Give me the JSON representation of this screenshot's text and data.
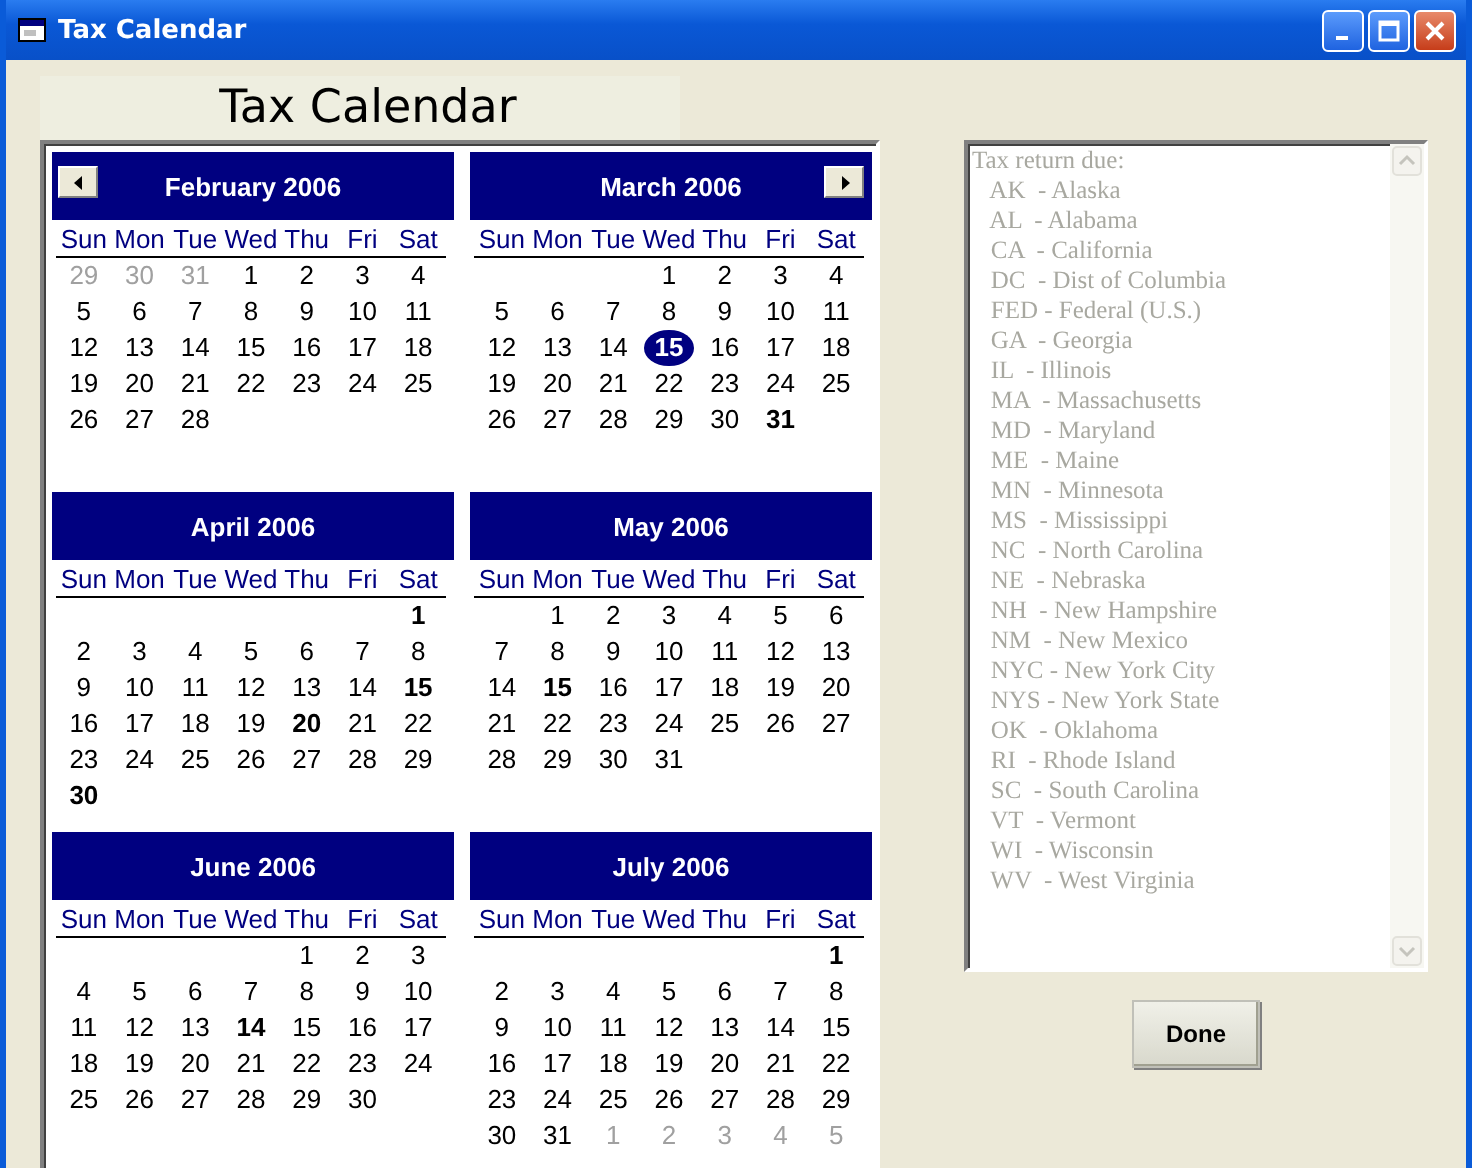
{
  "window": {
    "title": "Tax Calendar"
  },
  "heading": "Tax Calendar",
  "calendar": {
    "months": [
      {
        "title": "February 2006",
        "prev_button": true,
        "next_button": false,
        "weekdays": [
          "Sun",
          "Mon",
          "Tue",
          "Wed",
          "Thu",
          "Fri",
          "Sat"
        ],
        "weeks": [
          [
            {
              "day": "29",
              "kind": "adjacent"
            },
            {
              "day": "30",
              "kind": "adjacent"
            },
            {
              "day": "31",
              "kind": "adjacent"
            },
            {
              "day": "1",
              "kind": "normal"
            },
            {
              "day": "2",
              "kind": "normal"
            },
            {
              "day": "3",
              "kind": "normal"
            },
            {
              "day": "4",
              "kind": "normal"
            }
          ],
          [
            {
              "day": "5",
              "kind": "normal"
            },
            {
              "day": "6",
              "kind": "normal"
            },
            {
              "day": "7",
              "kind": "normal"
            },
            {
              "day": "8",
              "kind": "normal"
            },
            {
              "day": "9",
              "kind": "normal"
            },
            {
              "day": "10",
              "kind": "normal"
            },
            {
              "day": "11",
              "kind": "normal"
            }
          ],
          [
            {
              "day": "12",
              "kind": "normal"
            },
            {
              "day": "13",
              "kind": "normal"
            },
            {
              "day": "14",
              "kind": "normal"
            },
            {
              "day": "15",
              "kind": "normal"
            },
            {
              "day": "16",
              "kind": "normal"
            },
            {
              "day": "17",
              "kind": "normal"
            },
            {
              "day": "18",
              "kind": "normal"
            }
          ],
          [
            {
              "day": "19",
              "kind": "normal"
            },
            {
              "day": "20",
              "kind": "normal"
            },
            {
              "day": "21",
              "kind": "normal"
            },
            {
              "day": "22",
              "kind": "normal"
            },
            {
              "day": "23",
              "kind": "normal"
            },
            {
              "day": "24",
              "kind": "normal"
            },
            {
              "day": "25",
              "kind": "normal"
            }
          ],
          [
            {
              "day": "26",
              "kind": "normal"
            },
            {
              "day": "27",
              "kind": "normal"
            },
            {
              "day": "28",
              "kind": "normal"
            },
            {
              "kind": "blank"
            },
            {
              "kind": "blank"
            },
            {
              "kind": "blank"
            },
            {
              "kind": "blank"
            }
          ]
        ]
      },
      {
        "title": "March 2006",
        "prev_button": false,
        "next_button": true,
        "weekdays": [
          "Sun",
          "Mon",
          "Tue",
          "Wed",
          "Thu",
          "Fri",
          "Sat"
        ],
        "weeks": [
          [
            {
              "kind": "blank"
            },
            {
              "kind": "blank"
            },
            {
              "kind": "blank"
            },
            {
              "day": "1",
              "kind": "normal"
            },
            {
              "day": "2",
              "kind": "normal"
            },
            {
              "day": "3",
              "kind": "normal"
            },
            {
              "day": "4",
              "kind": "normal"
            }
          ],
          [
            {
              "day": "5",
              "kind": "normal"
            },
            {
              "day": "6",
              "kind": "normal"
            },
            {
              "day": "7",
              "kind": "normal"
            },
            {
              "day": "8",
              "kind": "normal"
            },
            {
              "day": "9",
              "kind": "normal"
            },
            {
              "day": "10",
              "kind": "normal"
            },
            {
              "day": "11",
              "kind": "normal"
            }
          ],
          [
            {
              "day": "12",
              "kind": "normal"
            },
            {
              "day": "13",
              "kind": "normal"
            },
            {
              "day": "14",
              "kind": "normal"
            },
            {
              "day": "15",
              "kind": "today"
            },
            {
              "day": "16",
              "kind": "normal"
            },
            {
              "day": "17",
              "kind": "normal"
            },
            {
              "day": "18",
              "kind": "normal"
            }
          ],
          [
            {
              "day": "19",
              "kind": "normal"
            },
            {
              "day": "20",
              "kind": "normal"
            },
            {
              "day": "21",
              "kind": "normal"
            },
            {
              "day": "22",
              "kind": "normal"
            },
            {
              "day": "23",
              "kind": "normal"
            },
            {
              "day": "24",
              "kind": "normal"
            },
            {
              "day": "25",
              "kind": "normal"
            }
          ],
          [
            {
              "day": "26",
              "kind": "normal"
            },
            {
              "day": "27",
              "kind": "normal"
            },
            {
              "day": "28",
              "kind": "normal"
            },
            {
              "day": "29",
              "kind": "normal"
            },
            {
              "day": "30",
              "kind": "normal"
            },
            {
              "day": "31",
              "kind": "bold"
            },
            {
              "kind": "blank"
            }
          ]
        ]
      },
      {
        "title": "April 2006",
        "prev_button": false,
        "next_button": false,
        "weekdays": [
          "Sun",
          "Mon",
          "Tue",
          "Wed",
          "Thu",
          "Fri",
          "Sat"
        ],
        "weeks": [
          [
            {
              "kind": "blank"
            },
            {
              "kind": "blank"
            },
            {
              "kind": "blank"
            },
            {
              "kind": "blank"
            },
            {
              "kind": "blank"
            },
            {
              "kind": "blank"
            },
            {
              "day": "1",
              "kind": "bold"
            }
          ],
          [
            {
              "day": "2",
              "kind": "normal"
            },
            {
              "day": "3",
              "kind": "normal"
            },
            {
              "day": "4",
              "kind": "normal"
            },
            {
              "day": "5",
              "kind": "normal"
            },
            {
              "day": "6",
              "kind": "normal"
            },
            {
              "day": "7",
              "kind": "normal"
            },
            {
              "day": "8",
              "kind": "normal"
            }
          ],
          [
            {
              "day": "9",
              "kind": "normal"
            },
            {
              "day": "10",
              "kind": "normal"
            },
            {
              "day": "11",
              "kind": "normal"
            },
            {
              "day": "12",
              "kind": "normal"
            },
            {
              "day": "13",
              "kind": "normal"
            },
            {
              "day": "14",
              "kind": "normal"
            },
            {
              "day": "15",
              "kind": "bold"
            }
          ],
          [
            {
              "day": "16",
              "kind": "normal"
            },
            {
              "day": "17",
              "kind": "normal"
            },
            {
              "day": "18",
              "kind": "normal"
            },
            {
              "day": "19",
              "kind": "normal"
            },
            {
              "day": "20",
              "kind": "bold"
            },
            {
              "day": "21",
              "kind": "normal"
            },
            {
              "day": "22",
              "kind": "normal"
            }
          ],
          [
            {
              "day": "23",
              "kind": "normal"
            },
            {
              "day": "24",
              "kind": "normal"
            },
            {
              "day": "25",
              "kind": "normal"
            },
            {
              "day": "26",
              "kind": "normal"
            },
            {
              "day": "27",
              "kind": "normal"
            },
            {
              "day": "28",
              "kind": "normal"
            },
            {
              "day": "29",
              "kind": "normal"
            }
          ],
          [
            {
              "day": "30",
              "kind": "bold"
            },
            {
              "kind": "blank"
            },
            {
              "kind": "blank"
            },
            {
              "kind": "blank"
            },
            {
              "kind": "blank"
            },
            {
              "kind": "blank"
            },
            {
              "kind": "blank"
            }
          ]
        ]
      },
      {
        "title": "May 2006",
        "prev_button": false,
        "next_button": false,
        "weekdays": [
          "Sun",
          "Mon",
          "Tue",
          "Wed",
          "Thu",
          "Fri",
          "Sat"
        ],
        "weeks": [
          [
            {
              "kind": "blank"
            },
            {
              "day": "1",
              "kind": "normal"
            },
            {
              "day": "2",
              "kind": "normal"
            },
            {
              "day": "3",
              "kind": "normal"
            },
            {
              "day": "4",
              "kind": "normal"
            },
            {
              "day": "5",
              "kind": "normal"
            },
            {
              "day": "6",
              "kind": "normal"
            }
          ],
          [
            {
              "day": "7",
              "kind": "normal"
            },
            {
              "day": "8",
              "kind": "normal"
            },
            {
              "day": "9",
              "kind": "normal"
            },
            {
              "day": "10",
              "kind": "normal"
            },
            {
              "day": "11",
              "kind": "normal"
            },
            {
              "day": "12",
              "kind": "normal"
            },
            {
              "day": "13",
              "kind": "normal"
            }
          ],
          [
            {
              "day": "14",
              "kind": "normal"
            },
            {
              "day": "15",
              "kind": "bold"
            },
            {
              "day": "16",
              "kind": "normal"
            },
            {
              "day": "17",
              "kind": "normal"
            },
            {
              "day": "18",
              "kind": "normal"
            },
            {
              "day": "19",
              "kind": "normal"
            },
            {
              "day": "20",
              "kind": "normal"
            }
          ],
          [
            {
              "day": "21",
              "kind": "normal"
            },
            {
              "day": "22",
              "kind": "normal"
            },
            {
              "day": "23",
              "kind": "normal"
            },
            {
              "day": "24",
              "kind": "normal"
            },
            {
              "day": "25",
              "kind": "normal"
            },
            {
              "day": "26",
              "kind": "normal"
            },
            {
              "day": "27",
              "kind": "normal"
            }
          ],
          [
            {
              "day": "28",
              "kind": "normal"
            },
            {
              "day": "29",
              "kind": "normal"
            },
            {
              "day": "30",
              "kind": "normal"
            },
            {
              "day": "31",
              "kind": "normal"
            },
            {
              "kind": "blank"
            },
            {
              "kind": "blank"
            },
            {
              "kind": "blank"
            }
          ]
        ]
      },
      {
        "title": "June 2006",
        "prev_button": false,
        "next_button": false,
        "weekdays": [
          "Sun",
          "Mon",
          "Tue",
          "Wed",
          "Thu",
          "Fri",
          "Sat"
        ],
        "weeks": [
          [
            {
              "kind": "blank"
            },
            {
              "kind": "blank"
            },
            {
              "kind": "blank"
            },
            {
              "kind": "blank"
            },
            {
              "day": "1",
              "kind": "normal"
            },
            {
              "day": "2",
              "kind": "normal"
            },
            {
              "day": "3",
              "kind": "normal"
            }
          ],
          [
            {
              "day": "4",
              "kind": "normal"
            },
            {
              "day": "5",
              "kind": "normal"
            },
            {
              "day": "6",
              "kind": "normal"
            },
            {
              "day": "7",
              "kind": "normal"
            },
            {
              "day": "8",
              "kind": "normal"
            },
            {
              "day": "9",
              "kind": "normal"
            },
            {
              "day": "10",
              "kind": "normal"
            }
          ],
          [
            {
              "day": "11",
              "kind": "normal"
            },
            {
              "day": "12",
              "kind": "normal"
            },
            {
              "day": "13",
              "kind": "normal"
            },
            {
              "day": "14",
              "kind": "bold"
            },
            {
              "day": "15",
              "kind": "normal"
            },
            {
              "day": "16",
              "kind": "normal"
            },
            {
              "day": "17",
              "kind": "normal"
            }
          ],
          [
            {
              "day": "18",
              "kind": "normal"
            },
            {
              "day": "19",
              "kind": "normal"
            },
            {
              "day": "20",
              "kind": "normal"
            },
            {
              "day": "21",
              "kind": "normal"
            },
            {
              "day": "22",
              "kind": "normal"
            },
            {
              "day": "23",
              "kind": "normal"
            },
            {
              "day": "24",
              "kind": "normal"
            }
          ],
          [
            {
              "day": "25",
              "kind": "normal"
            },
            {
              "day": "26",
              "kind": "normal"
            },
            {
              "day": "27",
              "kind": "normal"
            },
            {
              "day": "28",
              "kind": "normal"
            },
            {
              "day": "29",
              "kind": "normal"
            },
            {
              "day": "30",
              "kind": "normal"
            },
            {
              "kind": "blank"
            }
          ]
        ]
      },
      {
        "title": "July 2006",
        "prev_button": false,
        "next_button": false,
        "weekdays": [
          "Sun",
          "Mon",
          "Tue",
          "Wed",
          "Thu",
          "Fri",
          "Sat"
        ],
        "weeks": [
          [
            {
              "kind": "blank"
            },
            {
              "kind": "blank"
            },
            {
              "kind": "blank"
            },
            {
              "kind": "blank"
            },
            {
              "kind": "blank"
            },
            {
              "kind": "blank"
            },
            {
              "day": "1",
              "kind": "bold"
            }
          ],
          [
            {
              "day": "2",
              "kind": "normal"
            },
            {
              "day": "3",
              "kind": "normal"
            },
            {
              "day": "4",
              "kind": "normal"
            },
            {
              "day": "5",
              "kind": "normal"
            },
            {
              "day": "6",
              "kind": "normal"
            },
            {
              "day": "7",
              "kind": "normal"
            },
            {
              "day": "8",
              "kind": "normal"
            }
          ],
          [
            {
              "day": "9",
              "kind": "normal"
            },
            {
              "day": "10",
              "kind": "normal"
            },
            {
              "day": "11",
              "kind": "normal"
            },
            {
              "day": "12",
              "kind": "normal"
            },
            {
              "day": "13",
              "kind": "normal"
            },
            {
              "day": "14",
              "kind": "normal"
            },
            {
              "day": "15",
              "kind": "normal"
            }
          ],
          [
            {
              "day": "16",
              "kind": "normal"
            },
            {
              "day": "17",
              "kind": "normal"
            },
            {
              "day": "18",
              "kind": "normal"
            },
            {
              "day": "19",
              "kind": "normal"
            },
            {
              "day": "20",
              "kind": "normal"
            },
            {
              "day": "21",
              "kind": "normal"
            },
            {
              "day": "22",
              "kind": "normal"
            }
          ],
          [
            {
              "day": "23",
              "kind": "normal"
            },
            {
              "day": "24",
              "kind": "normal"
            },
            {
              "day": "25",
              "kind": "normal"
            },
            {
              "day": "26",
              "kind": "normal"
            },
            {
              "day": "27",
              "kind": "normal"
            },
            {
              "day": "28",
              "kind": "normal"
            },
            {
              "day": "29",
              "kind": "normal"
            }
          ],
          [
            {
              "day": "30",
              "kind": "normal"
            },
            {
              "day": "31",
              "kind": "normal"
            },
            {
              "day": "1",
              "kind": "adjacent"
            },
            {
              "day": "2",
              "kind": "adjacent"
            },
            {
              "day": "3",
              "kind": "adjacent"
            },
            {
              "day": "4",
              "kind": "adjacent"
            },
            {
              "day": "5",
              "kind": "adjacent"
            }
          ]
        ]
      }
    ]
  },
  "list_box": {
    "disabled": true,
    "items": [
      "Tax return due:",
      "   AK  - Alaska",
      "   AL  - Alabama",
      "   CA  - California",
      "   DC  - Dist of Columbia",
      "   FED - Federal (U.S.)",
      "   GA  - Georgia",
      "   IL  - Illinois",
      "   MA  - Massachusetts",
      "   MD  - Maryland",
      "   ME  - Maine",
      "   MN  - Minnesota",
      "   MS  - Mississippi",
      "   NC  - North Carolina",
      "   NE  - Nebraska",
      "   NH  - New Hampshire",
      "   NM  - New Mexico",
      "   NYC - New York City",
      "   NYS - New York State",
      "   OK  - Oklahoma",
      "   RI  - Rhode Island",
      "   SC  - South Carolina",
      "   VT  - Vermont",
      "   WI  - Wisconsin",
      "   WV  - West Virginia"
    ]
  },
  "buttons": [
    "Done"
  ]
}
